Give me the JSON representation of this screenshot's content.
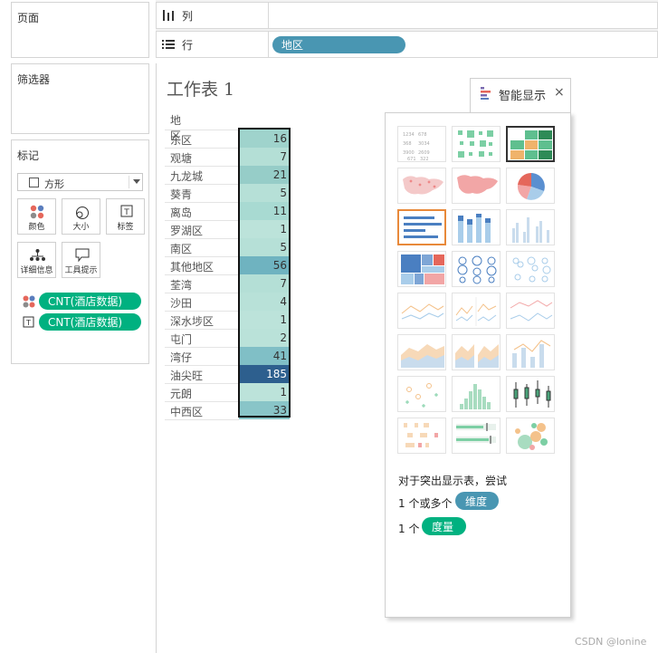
{
  "sidebar": {
    "pages_title": "页面",
    "filters_title": "筛选器",
    "marks_title": "标记",
    "mark_type": "方形",
    "mark_cards": [
      {
        "label": "颜色",
        "icon": "color-icon"
      },
      {
        "label": "大小",
        "icon": "size-icon"
      },
      {
        "label": "标签",
        "icon": "label-icon"
      },
      {
        "label": "详细信息",
        "icon": "detail-icon"
      },
      {
        "label": "工具提示",
        "icon": "tooltip-icon"
      }
    ],
    "mark_fields": [
      {
        "label": "CNT(酒店数据)",
        "icon": "color-icon"
      },
      {
        "label": "CNT(酒店数据)",
        "icon": "label-icon"
      }
    ]
  },
  "shelves": {
    "columns_label": "列",
    "rows_label": "行",
    "rows_pill": "地区"
  },
  "worksheet": {
    "title": "工作表 1",
    "header": "地区",
    "rows": [
      {
        "name": "东区",
        "value": "16",
        "color": "#9fd3cc"
      },
      {
        "name": "观塘",
        "value": "7",
        "color": "#b4dfd6"
      },
      {
        "name": "九龙城",
        "value": "21",
        "color": "#96cdc8"
      },
      {
        "name": "葵青",
        "value": "5",
        "color": "#b6e0d7"
      },
      {
        "name": "离岛",
        "value": "11",
        "color": "#a8dad2"
      },
      {
        "name": "罗湖区",
        "value": "1",
        "color": "#bce3da"
      },
      {
        "name": "南区",
        "value": "5",
        "color": "#b6e0d7"
      },
      {
        "name": "其他地区",
        "value": "56",
        "color": "#6fb3c0"
      },
      {
        "name": "荃湾",
        "value": "7",
        "color": "#b4dfd6"
      },
      {
        "name": "沙田",
        "value": "4",
        "color": "#b8e1d8"
      },
      {
        "name": "深水埗区",
        "value": "1",
        "color": "#bce3da"
      },
      {
        "name": "屯门",
        "value": "2",
        "color": "#bae2d9"
      },
      {
        "name": "湾仔",
        "value": "41",
        "color": "#80bfc6"
      },
      {
        "name": "油尖旺",
        "value": "185",
        "color": "#2d5f8e",
        "text_color": "#ffffff"
      },
      {
        "name": "元朗",
        "value": "1",
        "color": "#bce3da"
      },
      {
        "name": "中西区",
        "value": "33",
        "color": "#89c5c8"
      }
    ]
  },
  "showme": {
    "title": "智能显示",
    "close_glyph": "×",
    "hint_text": "对于突出显示表，尝试",
    "req1_prefix": "1 个或多个",
    "req1_pill": "维度",
    "req2_prefix": "1 个",
    "req2_pill": "度量",
    "thumbs": [
      "text-table",
      "heat-map",
      "highlight-table",
      "symbol-map",
      "filled-map",
      "pie-chart",
      "horizontal-bars",
      "stacked-bars",
      "side-by-side-bars",
      "treemap",
      "circle-views",
      "side-by-side-circles",
      "lines-continuous",
      "lines-discrete",
      "dual-lines",
      "area-continuous",
      "area-discrete",
      "dual-combination",
      "scatter-plot",
      "histogram",
      "box-and-whisker",
      "gantt-chart",
      "bullet-graph",
      "packed-bubbles"
    ]
  },
  "colors": {
    "dimension_pill": "#4996b2",
    "measure_pill": "#00b180",
    "selected_border_orange": "#e8893a"
  },
  "watermark": "CSDN @lonine"
}
